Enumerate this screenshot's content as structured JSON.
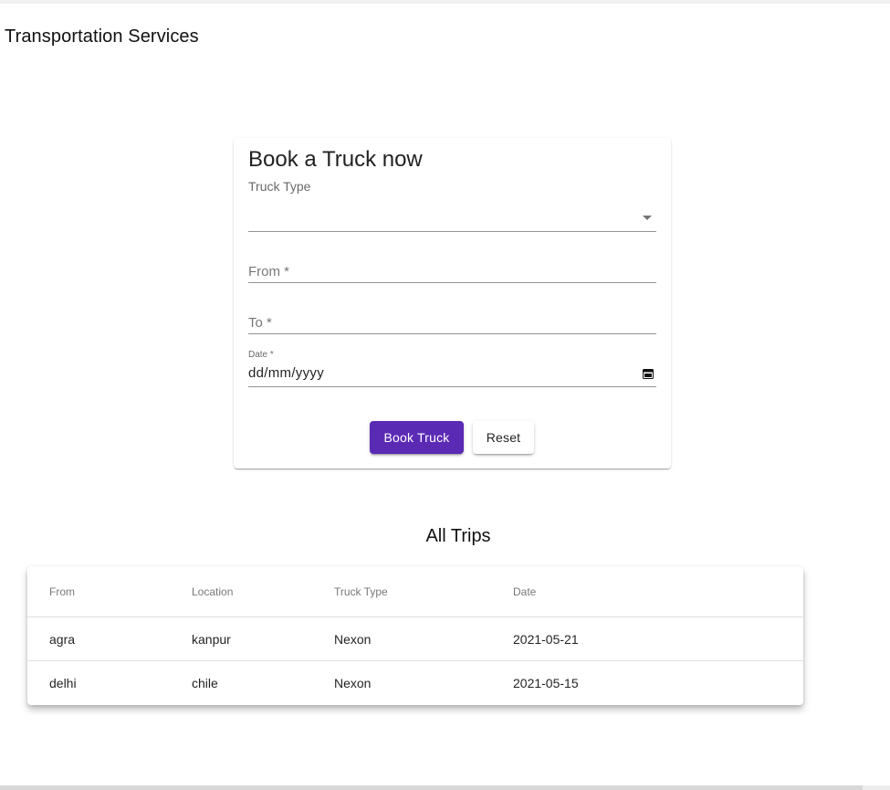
{
  "app": {
    "title": "Transportation Services"
  },
  "booking": {
    "title": "Book a Truck now",
    "truck_type_label": "Truck Type",
    "truck_type_value": "",
    "from_placeholder": "From *",
    "to_placeholder": "To *",
    "date_label": "Date *",
    "date_value": "dd/mm/yyyy",
    "book_button": "Book Truck",
    "reset_button": "Reset"
  },
  "trips": {
    "title": "All Trips",
    "columns": [
      "From",
      "Location",
      "Truck Type",
      "Date"
    ],
    "rows": [
      [
        "agra",
        "kanpur",
        "Nexon",
        "2021-05-21"
      ],
      [
        "delhi",
        "chile",
        "Nexon",
        "2021-05-15"
      ]
    ]
  },
  "colors": {
    "primary": "#5b2ab5"
  }
}
